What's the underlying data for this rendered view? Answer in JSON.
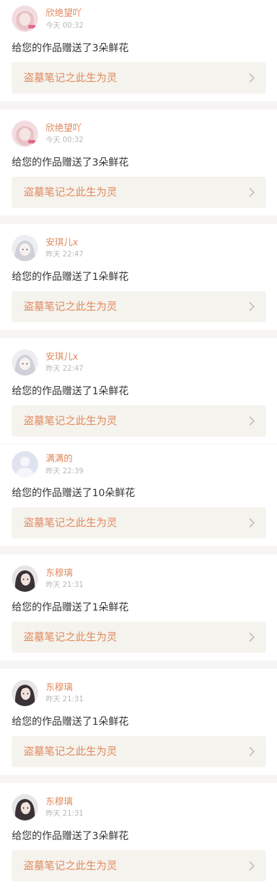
{
  "items": [
    {
      "username": "欣绝望吖",
      "time": "今天 00:32",
      "message": "给您的作品赠送了3朵鲜花",
      "work_title": "盗墓笔记之此生为灵",
      "avatar": "avatar-pink-girl"
    },
    {
      "username": "欣绝望吖",
      "time": "今天 00:32",
      "message": "给您的作品赠送了3朵鲜花",
      "work_title": "盗墓笔记之此生为灵",
      "avatar": "avatar-pink-girl"
    },
    {
      "username": "安琪儿x",
      "time": "昨天 22:47",
      "message": "给您的作品赠送了1朵鲜花",
      "work_title": "盗墓笔记之此生为灵",
      "avatar": "avatar-silver-hair-anime"
    },
    {
      "username": "安琪儿x",
      "time": "昨天 22:47",
      "message": "给您的作品赠送了1朵鲜花",
      "work_title": "盗墓笔记之此生为灵",
      "avatar": "avatar-silver-hair-anime"
    },
    {
      "username": "满满的",
      "time": "昨天 22:39",
      "message": "给您的作品赠送了10朵鲜花",
      "work_title": "盗墓笔记之此生为灵",
      "avatar": "avatar-default-user"
    },
    {
      "username": "东穆璃",
      "time": "昨天 21:31",
      "message": "给您的作品赠送了1朵鲜花",
      "work_title": "盗墓笔记之此生为灵",
      "avatar": "avatar-dark-hair-girl"
    },
    {
      "username": "东穆璃",
      "time": "昨天 21:31",
      "message": "给您的作品赠送了1朵鲜花",
      "work_title": "盗墓笔记之此生为灵",
      "avatar": "avatar-dark-hair-girl"
    },
    {
      "username": "东穆璃",
      "time": "昨天 21:31",
      "message": "给您的作品赠送了3朵鲜花",
      "work_title": "盗墓笔记之此生为灵",
      "avatar": "avatar-dark-hair-girl"
    }
  ],
  "colors": {
    "accent": "#e0895e",
    "text": "#333333",
    "muted": "#b8b8b8",
    "card_bg": "#f5f3ed",
    "separator": "#f7f5f4"
  }
}
